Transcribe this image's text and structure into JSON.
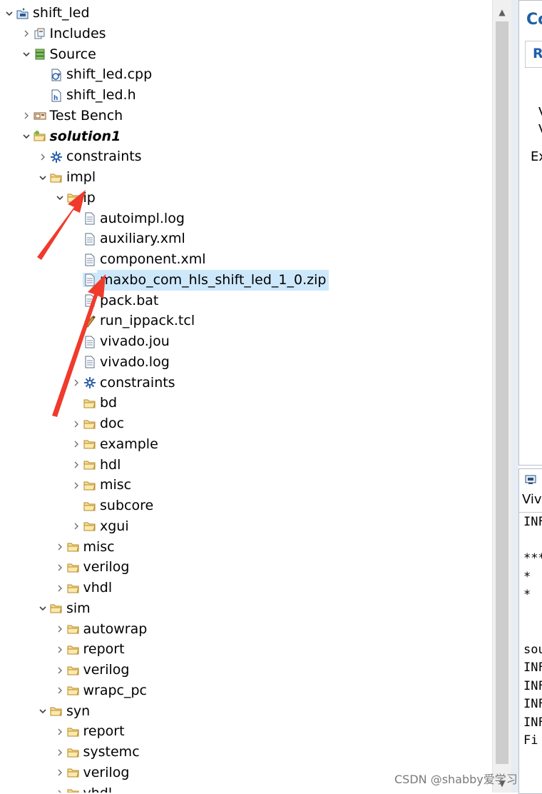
{
  "tree": [
    {
      "label": "shift_led",
      "depth": 0,
      "expand": "open",
      "icon": "project-icon"
    },
    {
      "label": "Includes",
      "depth": 1,
      "expand": "closed",
      "icon": "includes-icon"
    },
    {
      "label": "Source",
      "depth": 1,
      "expand": "open",
      "icon": "source-icon"
    },
    {
      "label": "shift_led.cpp",
      "depth": 2,
      "expand": "none",
      "icon": "cpp-file-icon"
    },
    {
      "label": "shift_led.h",
      "depth": 2,
      "expand": "none",
      "icon": "header-file-icon"
    },
    {
      "label": "Test Bench",
      "depth": 1,
      "expand": "closed",
      "icon": "testbench-icon"
    },
    {
      "label": "solution1",
      "depth": 1,
      "expand": "open",
      "icon": "solution-folder-icon",
      "bold": true
    },
    {
      "label": "constraints",
      "depth": 2,
      "expand": "closed",
      "icon": "constraints-icon"
    },
    {
      "label": "impl",
      "depth": 2,
      "expand": "open",
      "icon": "folder-icon"
    },
    {
      "label": "ip",
      "depth": 3,
      "expand": "open",
      "icon": "folder-icon"
    },
    {
      "label": "autoimpl.log",
      "depth": 4,
      "expand": "none",
      "icon": "file-icon"
    },
    {
      "label": "auxiliary.xml",
      "depth": 4,
      "expand": "none",
      "icon": "file-icon"
    },
    {
      "label": "component.xml",
      "depth": 4,
      "expand": "none",
      "icon": "file-icon"
    },
    {
      "label": "maxbo_com_hls_shift_led_1_0.zip",
      "depth": 4,
      "expand": "none",
      "icon": "file-icon",
      "selected": true
    },
    {
      "label": "pack.bat",
      "depth": 4,
      "expand": "none",
      "icon": "file-icon"
    },
    {
      "label": "run_ippack.tcl",
      "depth": 4,
      "expand": "none",
      "icon": "tcl-file-icon"
    },
    {
      "label": "vivado.jou",
      "depth": 4,
      "expand": "none",
      "icon": "file-icon"
    },
    {
      "label": "vivado.log",
      "depth": 4,
      "expand": "none",
      "icon": "file-icon"
    },
    {
      "label": "constraints",
      "depth": 4,
      "expand": "closed",
      "icon": "constraints-icon"
    },
    {
      "label": "bd",
      "depth": 4,
      "expand": "none",
      "icon": "folder-icon"
    },
    {
      "label": "doc",
      "depth": 4,
      "expand": "closed",
      "icon": "folder-icon"
    },
    {
      "label": "example",
      "depth": 4,
      "expand": "closed",
      "icon": "folder-icon"
    },
    {
      "label": "hdl",
      "depth": 4,
      "expand": "closed",
      "icon": "folder-icon"
    },
    {
      "label": "misc",
      "depth": 4,
      "expand": "closed",
      "icon": "folder-icon"
    },
    {
      "label": "subcore",
      "depth": 4,
      "expand": "none",
      "icon": "folder-icon"
    },
    {
      "label": "xgui",
      "depth": 4,
      "expand": "closed",
      "icon": "folder-icon"
    },
    {
      "label": "misc",
      "depth": 3,
      "expand": "closed",
      "icon": "folder-icon"
    },
    {
      "label": "verilog",
      "depth": 3,
      "expand": "closed",
      "icon": "folder-icon"
    },
    {
      "label": "vhdl",
      "depth": 3,
      "expand": "closed",
      "icon": "folder-icon"
    },
    {
      "label": "sim",
      "depth": 2,
      "expand": "open",
      "icon": "folder-icon"
    },
    {
      "label": "autowrap",
      "depth": 3,
      "expand": "closed",
      "icon": "folder-icon"
    },
    {
      "label": "report",
      "depth": 3,
      "expand": "closed",
      "icon": "folder-icon"
    },
    {
      "label": "verilog",
      "depth": 3,
      "expand": "closed",
      "icon": "folder-icon"
    },
    {
      "label": "wrapc_pc",
      "depth": 3,
      "expand": "closed",
      "icon": "folder-icon"
    },
    {
      "label": "syn",
      "depth": 2,
      "expand": "open",
      "icon": "folder-icon"
    },
    {
      "label": "report",
      "depth": 3,
      "expand": "closed",
      "icon": "folder-icon"
    },
    {
      "label": "systemc",
      "depth": 3,
      "expand": "closed",
      "icon": "folder-icon"
    },
    {
      "label": "verilog",
      "depth": 3,
      "expand": "closed",
      "icon": "folder-icon"
    },
    {
      "label": "vhdl",
      "depth": 3,
      "expand": "closed",
      "icon": "folder-icon"
    }
  ],
  "right_panel": {
    "title_fragment": "Co",
    "tab_fragment": "R",
    "line_1": "V",
    "line_2": "V",
    "line_3": "Ex",
    "console_tab_fragment": "",
    "console_title_fragment": "Viv",
    "console_lines": [
      "INF",
      "",
      "***",
      "  *",
      "  *",
      "",
      "",
      "sou",
      "INF",
      "INF",
      "INF",
      "INF",
      "Fi"
    ]
  },
  "watermark": "CSDN @shabby爱学习",
  "colors": {
    "selection": "#cde8fb",
    "folder": "#e8c470",
    "arrow": "#f03a2c",
    "accent": "#1f5fa8"
  }
}
